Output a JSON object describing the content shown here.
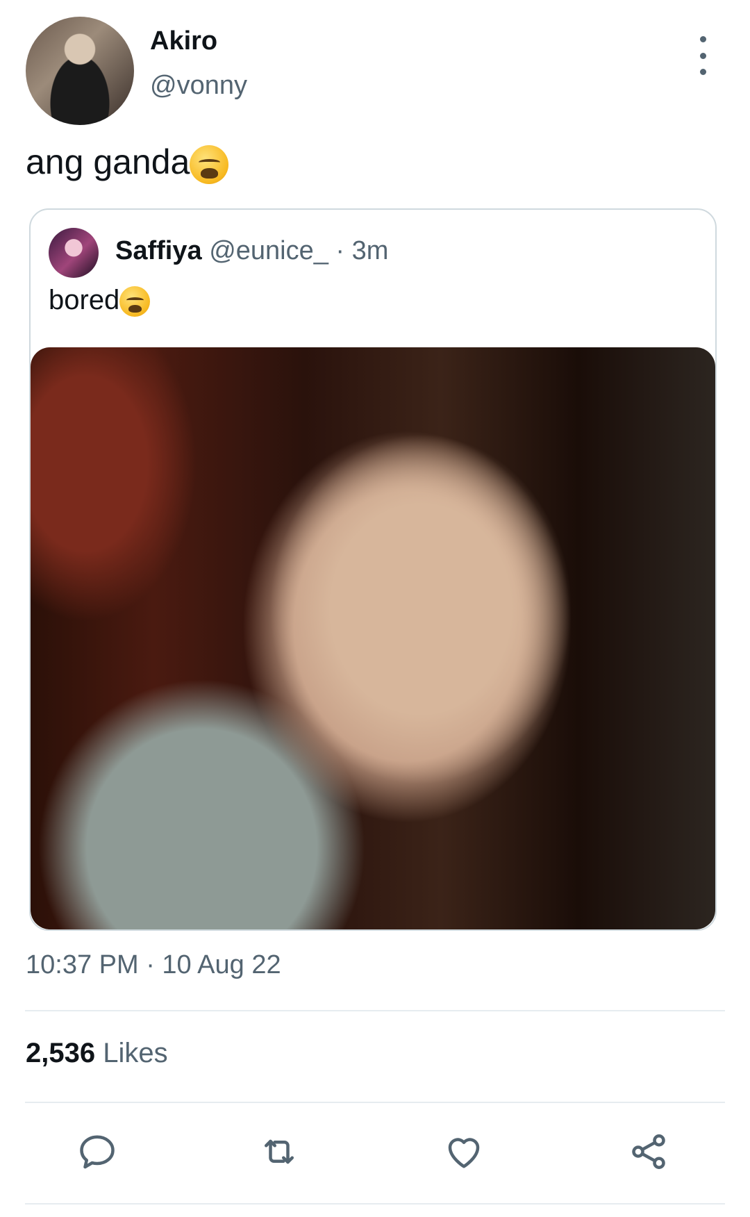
{
  "author": {
    "name": "Akiro",
    "handle": "@vonny"
  },
  "tweet": {
    "text": "ang ganda"
  },
  "quoted_tweet": {
    "name": "Saffiya",
    "handle": "@eunice_",
    "time_sep": " · ",
    "time": "3m",
    "text": "bored"
  },
  "timestamp": "10:37 PM · 10 Aug 22",
  "likes": {
    "count": "2,536",
    "label": "Likes"
  },
  "actions": [
    {
      "icon": "reply-icon"
    },
    {
      "icon": "retweet-icon"
    },
    {
      "icon": "like-icon"
    },
    {
      "icon": "share-icon"
    }
  ],
  "colors": {
    "text_primary": "#0f1419",
    "text_secondary": "#536471",
    "border": "#cfd9de",
    "divider": "#e6ecf0"
  }
}
